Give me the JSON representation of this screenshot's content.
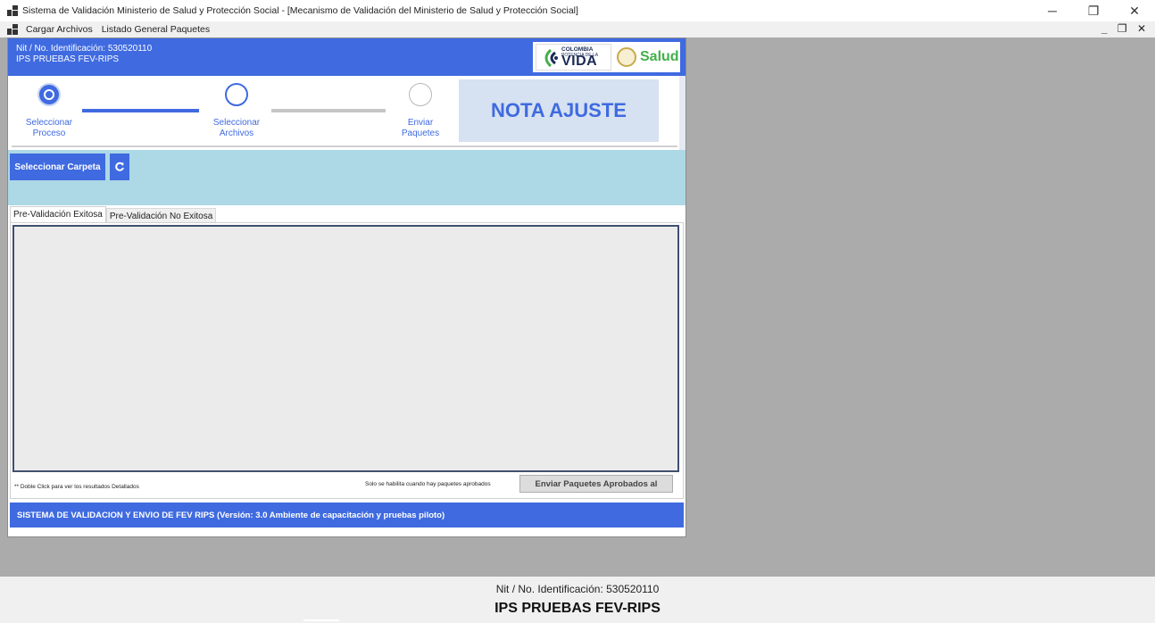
{
  "window": {
    "title": "Sistema de Validación Ministerio de Salud y Protección Social - [Mecanismo de Validación del Ministerio de Salud y Protección Social]",
    "minimize": "─",
    "restore": "❐",
    "close": "✕"
  },
  "menu": {
    "items": [
      "Cargar Archivos",
      "Listado General Paquetes"
    ],
    "mdi_controls": "_ ❐ ✕"
  },
  "header": {
    "nit_line": "Nit / No. Identificación: 530520110",
    "ips_line": "IPS PRUEBAS FEV-RIPS",
    "logo_colombia": "COLOMBIA",
    "logo_potencia": "POTENCIA DE LA",
    "logo_vida": "VIDA",
    "logo_salud": "Salud"
  },
  "stepper": {
    "steps": [
      {
        "label1": "Seleccionar",
        "label2": "Proceso",
        "state": "done"
      },
      {
        "label1": "Seleccionar",
        "label2": "Archivos",
        "state": "active"
      },
      {
        "label1": "Enviar",
        "label2": "Paquetes",
        "state": "todo"
      }
    ],
    "nota": "NOTA AJUSTE"
  },
  "toolbar": {
    "select_folder": "Seleccionar Carpeta",
    "refresh_icon": "refresh-icon"
  },
  "tabs": [
    "Pre-Validación Exitosa",
    "Pre-Validación No Exitosa"
  ],
  "panel": {
    "hint": "** Doble Click para ver los resultados Detallados",
    "solo": "Solo se habilita cuando hay paquetes aprobados",
    "send_button": "Enviar Paquetes Aprobados al"
  },
  "footer": {
    "text": "SISTEMA DE VALIDACION Y ENVIO DE FEV RIPS  (Versión: 3.0 Ambiente de capacitación y pruebas piloto)"
  },
  "statusbar": {
    "nit": "Nit / No. Identificación: 530520110",
    "ips": "IPS PRUEBAS FEV-RIPS"
  },
  "colors": {
    "primary_blue": "#3f6ae0",
    "toolbar_blue": "#add8e6",
    "mdi_background": "#ababab"
  }
}
